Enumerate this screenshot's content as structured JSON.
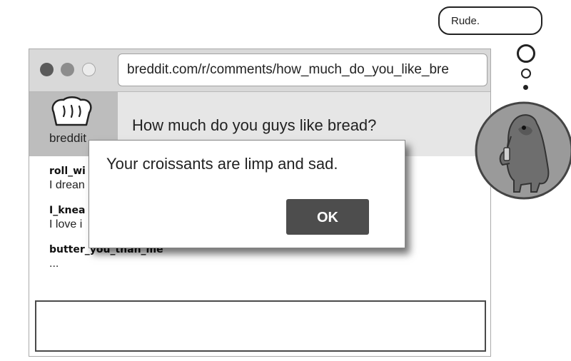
{
  "browser": {
    "url": "breddit.com/r/comments/how_much_do_you_like_bre",
    "window_controls": [
      "close-dot",
      "minimize-dot",
      "maximize-dot"
    ]
  },
  "subreddit": {
    "name": "breddit",
    "icon": "bread-loaf-icon"
  },
  "post": {
    "title": "How much do you guys like bread?"
  },
  "comments": [
    {
      "user": "roll_wi",
      "text": "I drean"
    },
    {
      "user": "I_knea",
      "text": "I love i"
    },
    {
      "user": "butter_you_than_me",
      "text": "..."
    }
  ],
  "reply_box": {
    "value": ""
  },
  "dialog": {
    "message": "Your croissants are limp and sad.",
    "ok_label": "OK"
  },
  "thought": {
    "text": "Rude.",
    "avatar_icon": "creature-avatar-icon"
  },
  "colors": {
    "chrome": "#d9d9d9",
    "sidebar": "#bdbdbd",
    "title_bar": "#e6e6e6",
    "ok_button": "#4d4d4d",
    "avatar_bg": "#9a9a9a"
  }
}
